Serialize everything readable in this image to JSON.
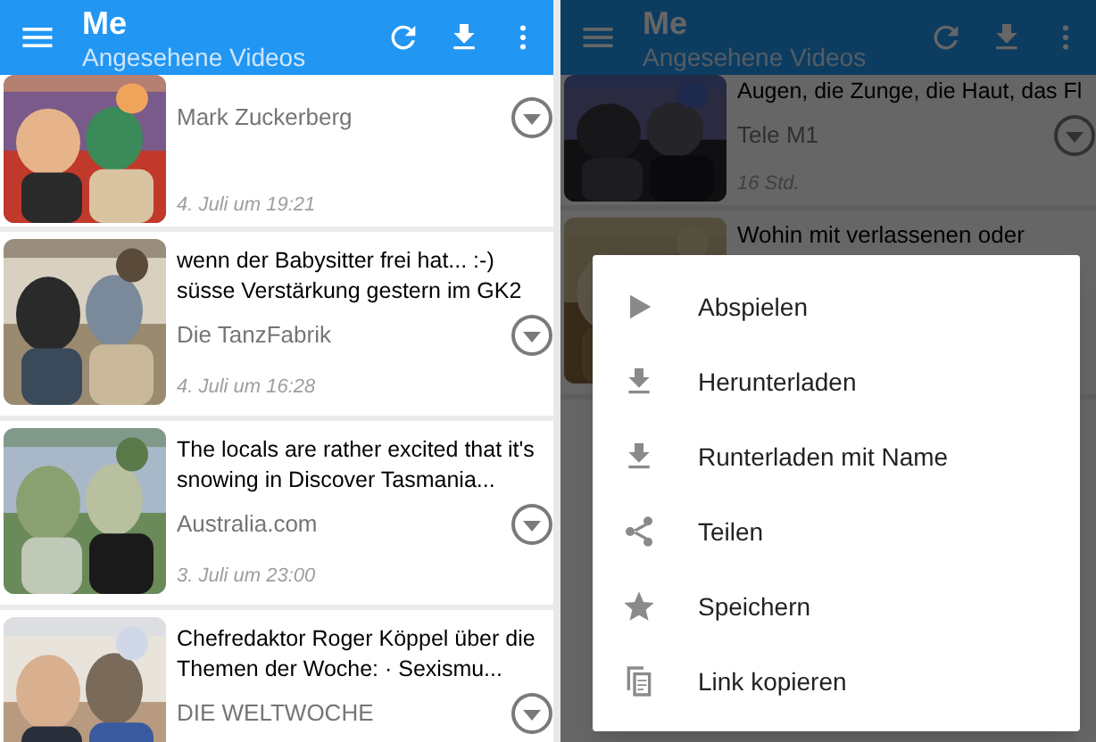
{
  "screens": [
    {
      "app_bar": {
        "title": "Me",
        "subtitle": "Angesehene Videos"
      },
      "videos": [
        {
          "channel": "Mark Zuckerberg",
          "time": "4. Juli um 19:21"
        },
        {
          "title": "wenn der Babysitter frei hat... :-) süsse Verstärkung gestern im GK2",
          "channel": "Die TanzFabrik",
          "time": "4. Juli um 16:28"
        },
        {
          "title": "The locals are rather excited that it's snowing in Discover Tasmania...",
          "channel": "Australia.com",
          "time": "3. Juli um 23:00"
        },
        {
          "title": "Chefredaktor Roger Köppel über die Themen der Woche: · Sexismu...",
          "channel": "DIE WELTWOCHE"
        }
      ]
    },
    {
      "app_bar": {
        "title": "Me",
        "subtitle": "Angesehene Videos"
      },
      "dimmed": true,
      "videos": [
        {
          "title": "Augen, die Zunge, die Haut, das Fl",
          "channel": "Tele M1",
          "time": "16 Std."
        },
        {
          "title": "Wohin mit verlassenen oder"
        }
      ],
      "context_menu": [
        {
          "kind": "play",
          "label": "Abspielen"
        },
        {
          "kind": "download",
          "label": "Herunterladen"
        },
        {
          "kind": "download",
          "label": "Runterladen mit Name"
        },
        {
          "kind": "share",
          "label": "Teilen"
        },
        {
          "kind": "star",
          "label": "Speichern"
        },
        {
          "kind": "copy",
          "label": "Link kopieren"
        }
      ]
    }
  ]
}
